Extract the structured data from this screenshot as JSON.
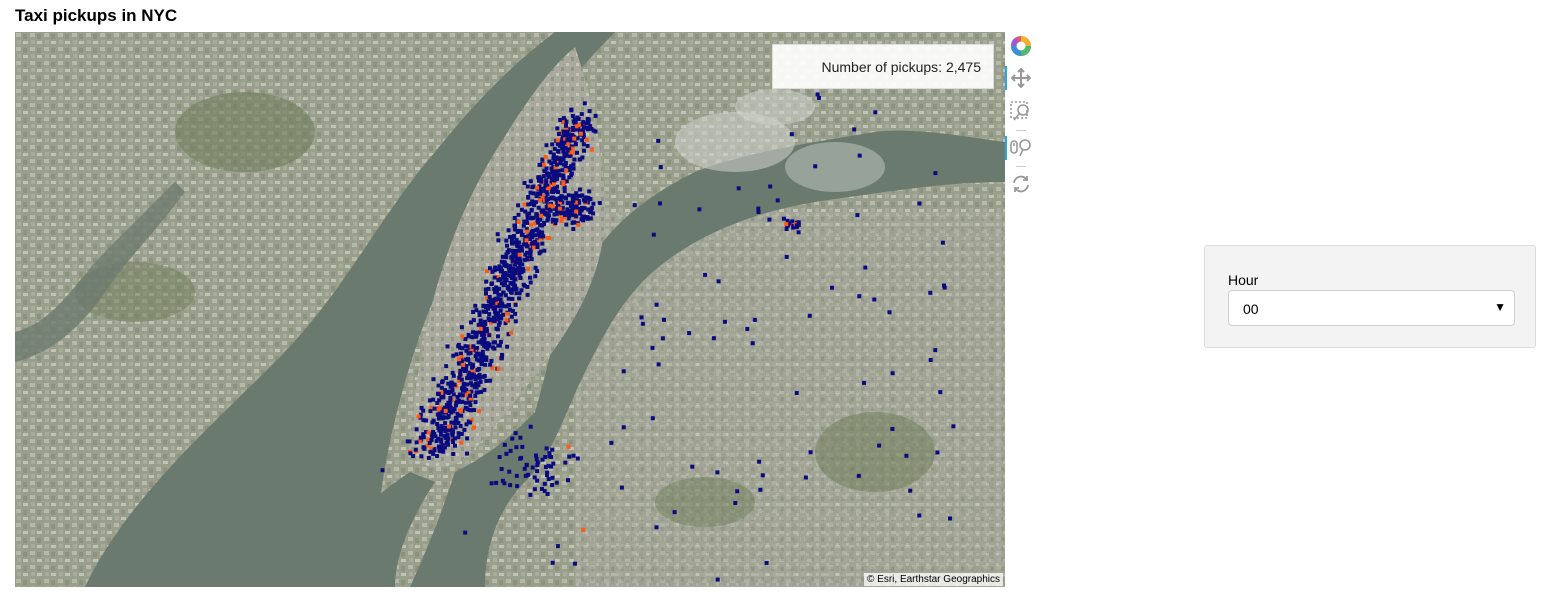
{
  "title": "Taxi pickups in NYC",
  "map": {
    "pickups_label": "Number of pickups: 2,475",
    "attribution": "© Esri, Earthstar Geographics",
    "point_colors": {
      "normal": "#0b0b80",
      "hot": "#ff5a14"
    }
  },
  "toolbar": {
    "tools": [
      {
        "name": "bokeh-logo-icon",
        "active": false
      },
      {
        "name": "pan-icon",
        "active": true
      },
      {
        "name": "box-zoom-icon",
        "active": false
      },
      {
        "name": "wheel-zoom-icon",
        "active": true
      },
      {
        "name": "reset-icon",
        "active": false
      }
    ]
  },
  "hour_widget": {
    "label": "Hour",
    "selected": "00"
  }
}
